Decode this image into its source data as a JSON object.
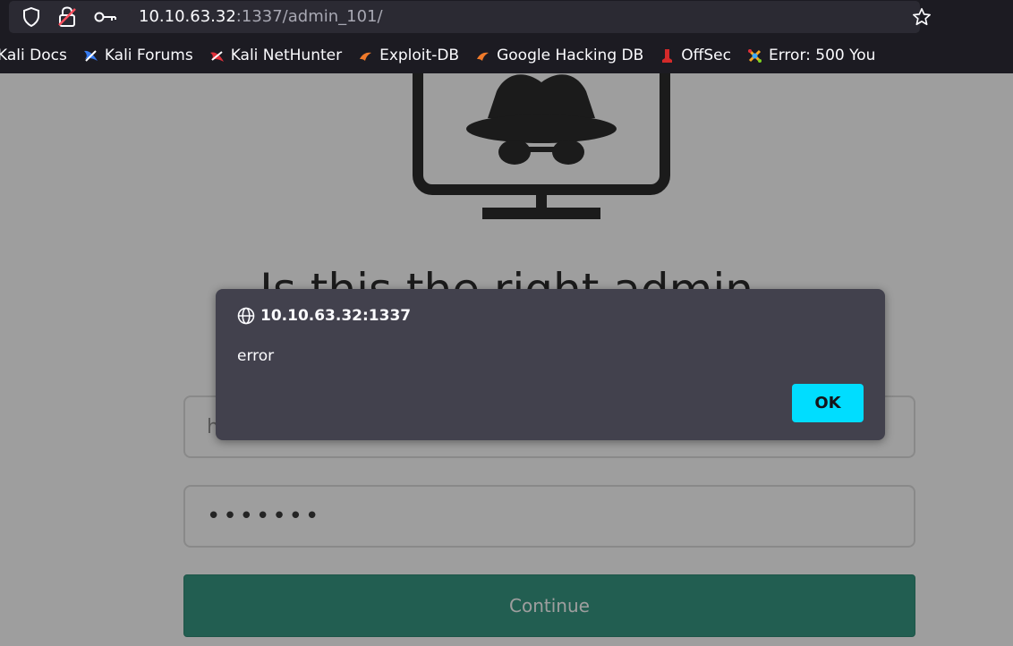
{
  "browser": {
    "url_host": "10.10.63.32",
    "url_path": ":1337/admin_101/",
    "bookmarks": [
      {
        "label": "Kali Docs",
        "icon": "kali-docs-icon"
      },
      {
        "label": "Kali Forums",
        "icon": "kali-forums-icon"
      },
      {
        "label": "Kali NetHunter",
        "icon": "nethunter-icon"
      },
      {
        "label": "Exploit-DB",
        "icon": "exploit-db-icon"
      },
      {
        "label": "Google Hacking DB",
        "icon": "ghdb-icon"
      },
      {
        "label": "OffSec",
        "icon": "offsec-icon"
      },
      {
        "label": "Error: 500 You",
        "icon": "error-page-icon"
      }
    ]
  },
  "page": {
    "heading": "Is this the right admin",
    "username_value": "h",
    "password_value": "•••••••",
    "continue_label": "Continue"
  },
  "dialog": {
    "origin": "10.10.63.32:1337",
    "message": "error",
    "ok_label": "OK"
  },
  "colors": {
    "continue_button": "#1e8a73",
    "ok_button": "#00ddff",
    "dialog_bg": "#42414d"
  }
}
